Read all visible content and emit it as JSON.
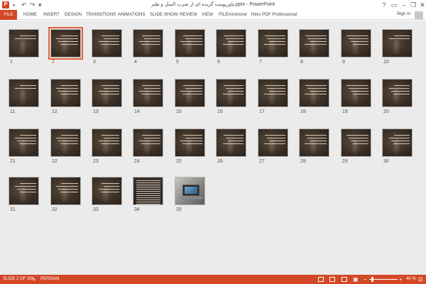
{
  "window": {
    "title": "پاورپوینت گزیده ای از ضرب المثل و طنز.pptx - PowerPoint",
    "help": "?",
    "minimize": "–",
    "restore": "❐",
    "close": "✕"
  },
  "qat": {
    "undo": "↶",
    "redo": "↷",
    "customize": "▾"
  },
  "ribbon": {
    "tabs": [
      "FILE",
      "HOME",
      "INSERT",
      "DESIGN",
      "TRANSITIONS",
      "ANIMATIONS",
      "SLIDE SHOW",
      "REVIEW",
      "VIEW",
      "FILEminimizer",
      "Nitro PDF Professional"
    ],
    "signin": "Sign in"
  },
  "sorter": {
    "selected": 2,
    "slides": [
      "1",
      "2",
      "3",
      "4",
      "5",
      "6",
      "7",
      "8",
      "9",
      "10",
      "11",
      "12",
      "13",
      "14",
      "15",
      "16",
      "17",
      "18",
      "19",
      "20",
      "21",
      "22",
      "23",
      "24",
      "25",
      "26",
      "27",
      "28",
      "29",
      "30",
      "31",
      "32",
      "33",
      "34",
      "35"
    ]
  },
  "status": {
    "slide_info": "SLIDE 2 OF 35",
    "language": "PERSIAN",
    "zoom_minus": "−",
    "zoom_plus": "+",
    "zoom": "40 %"
  },
  "colors": {
    "accent": "#d24726",
    "slide_bg": "#3d3127"
  }
}
